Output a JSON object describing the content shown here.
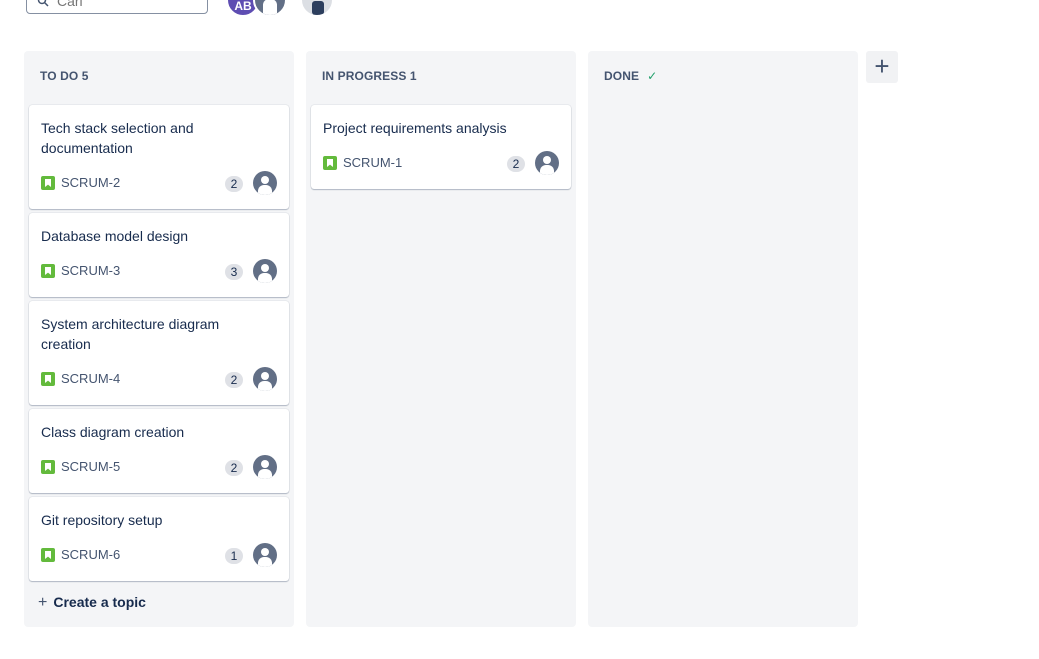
{
  "search": {
    "placeholder": "Cari"
  },
  "avatars": [
    {
      "initials": "AB",
      "color": "#5e4db2"
    }
  ],
  "board": {
    "columns": [
      {
        "title": "TO DO",
        "count": "5",
        "cards": [
          {
            "title": "Tech stack selection and documentation",
            "key": "SCRUM-2",
            "points": "2"
          },
          {
            "title": "Database model design",
            "key": "SCRUM-3",
            "points": "3"
          },
          {
            "title": "System architecture diagram creation",
            "key": "SCRUM-4",
            "points": "2"
          },
          {
            "title": "Class diagram creation",
            "key": "SCRUM-5",
            "points": "2"
          },
          {
            "title": "Git repository setup",
            "key": "SCRUM-6",
            "points": "1"
          }
        ],
        "create_label": "Create a topic"
      },
      {
        "title": "IN PROGRESS",
        "count": "1",
        "cards": [
          {
            "title": "Project requirements analysis",
            "key": "SCRUM-1",
            "points": "2"
          }
        ]
      },
      {
        "title": "DONE",
        "count": "",
        "cards": []
      }
    ],
    "add_column_label": "+"
  },
  "colors": {
    "story": "#63ba3c",
    "done_check": "#22a06b",
    "column_bg": "#f4f5f7"
  }
}
